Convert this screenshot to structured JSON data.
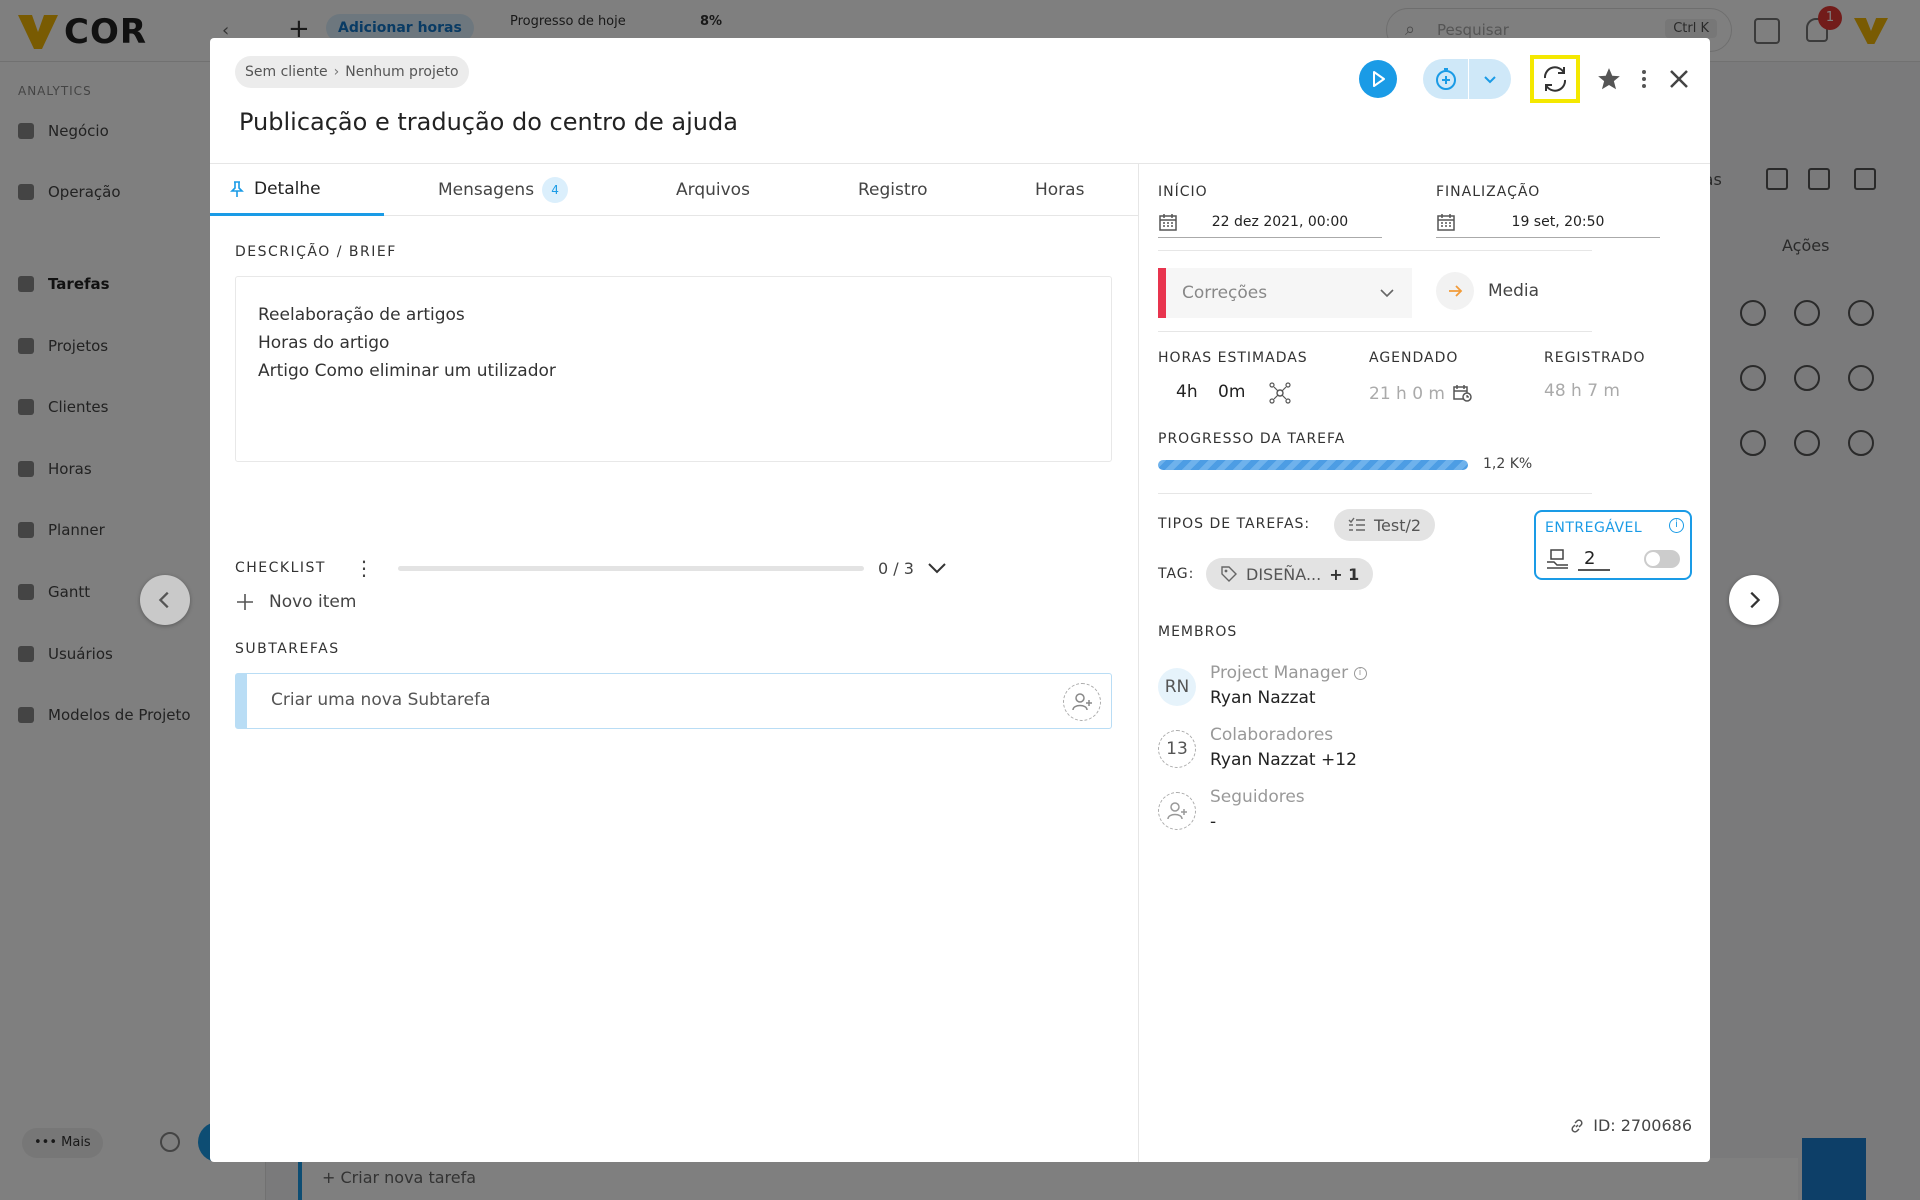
{
  "background": {
    "logo_text": "COR",
    "add_hours": "Adicionar horas",
    "progress_today_label": "Progresso de hoje",
    "progress_today_value": "8%",
    "search_placeholder": "Pesquisar",
    "search_shortcut": "Ctrl K",
    "notification_count": "1",
    "sidebar": {
      "section": "ANALYTICS",
      "items": [
        "Negócio",
        "Operação",
        "Tarefas",
        "Projetos",
        "Clientes",
        "Horas",
        "Planner",
        "Gantt",
        "Usuários",
        "Modelos de Projeto"
      ],
      "more": "••• Mais"
    },
    "header_fragment": "fas",
    "actions_header": "Ações",
    "new_task": "+ Criar nova tarefa"
  },
  "modal": {
    "breadcrumb": {
      "client": "Sem cliente",
      "project": "Nenhum projeto"
    },
    "title": "Publicação e tradução do centro de ajuda",
    "tabs": [
      {
        "label": "Detalhe",
        "active": true
      },
      {
        "label": "Mensagens",
        "badge": "4"
      },
      {
        "label": "Arquivos"
      },
      {
        "label": "Registro"
      },
      {
        "label": "Horas"
      }
    ],
    "description": {
      "label": "DESCRIÇÃO / BRIEF",
      "lines": [
        "Reelaboração de artigos",
        "Horas do artigo",
        "Artigo Como eliminar um utilizador"
      ]
    },
    "checklist": {
      "label": "CHECKLIST",
      "count": "0 / 3",
      "progress": 0,
      "new_item": "Novo item"
    },
    "subtasks": {
      "label": "SUBTAREFAS",
      "placeholder": "Criar uma nova Subtarefa"
    },
    "dates": {
      "start_label": "INÍCIO",
      "start_value": "22 dez 2021, 00:00",
      "end_label": "FINALIZAÇÃO",
      "end_value": "19 set, 20:50"
    },
    "status": {
      "value": "Correções",
      "color": "#e8344e"
    },
    "priority": {
      "value": "Media",
      "color": "#f29b38"
    },
    "hours": {
      "estimated_label": "HORAS ESTIMADAS",
      "estimated_h": "4h",
      "estimated_m": "0m",
      "scheduled_label": "AGENDADO",
      "scheduled_value": "21 h 0 m",
      "logged_label": "REGISTRADO",
      "logged_value": "48 h 7 m"
    },
    "progress": {
      "label": "PROGRESSO DA TAREFA",
      "value": "1,2 K%"
    },
    "task_types": {
      "label": "TIPOS DE TAREFAS:",
      "value": "Test/2"
    },
    "tags": {
      "label": "TAG:",
      "value": "DISEÑA...",
      "extra": "+ 1"
    },
    "deliverable": {
      "label": "ENTREGÁVEL",
      "value": "2",
      "enabled": false
    },
    "members": {
      "label": "MEMBROS",
      "pm_initials": "RN",
      "pm_role": "Project Manager",
      "pm_name": "Ryan Nazzat",
      "collab_count": "13",
      "collab_role": "Colaboradores",
      "collab_names": "Ryan Nazzat +12",
      "followers_role": "Seguidores",
      "followers_value": "-"
    },
    "task_id": "ID: 2700686"
  },
  "colors": {
    "accent": "#1a9be6",
    "highlight": "#f4e800"
  }
}
